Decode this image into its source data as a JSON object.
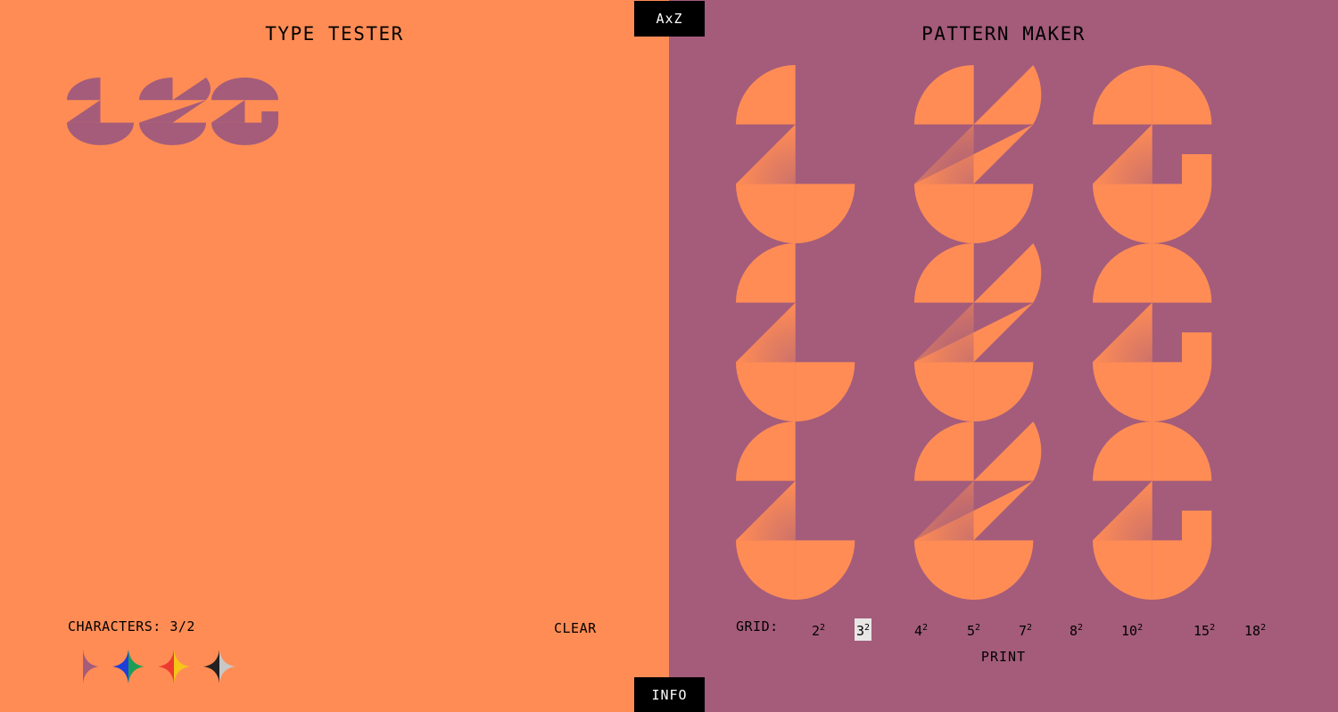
{
  "colors": {
    "orange": "#FF8C55",
    "mauve": "#A45C7A",
    "black": "#000000",
    "highlight": "#e9e6e6"
  },
  "top_tab": {
    "label": "AxZ"
  },
  "bottom_tab": {
    "label": "INFO"
  },
  "type_tester": {
    "title": "TYPE TESTER",
    "characters_label": "CHARACTERS: 3/2",
    "clear_label": "CLEAR",
    "typed_glyphs": [
      "L",
      "Z",
      "G"
    ],
    "color_swatches": [
      {
        "name": "orange-mauve",
        "colors": [
          "#A45C7A",
          "#FF8C55"
        ]
      },
      {
        "name": "green-blue",
        "colors": [
          "#1F9D57",
          "#1F3FDB"
        ]
      },
      {
        "name": "yellow-red",
        "colors": [
          "#F5C518",
          "#EE3B32"
        ]
      },
      {
        "name": "grey-black",
        "colors": [
          "#C8C8C8",
          "#222222"
        ]
      }
    ]
  },
  "pattern_maker": {
    "title": "PATTERN MAKER",
    "grid_label": "GRID:",
    "grid_options": [
      {
        "base": "2",
        "exp": "2"
      },
      {
        "base": "3",
        "exp": "2"
      },
      {
        "base": "4",
        "exp": "2"
      },
      {
        "base": "5",
        "exp": "2"
      },
      {
        "base": "7",
        "exp": "2"
      },
      {
        "base": "8",
        "exp": "2"
      },
      {
        "base": "10",
        "exp": "2"
      },
      {
        "base": "15",
        "exp": "2"
      },
      {
        "base": "18",
        "exp": "2"
      }
    ],
    "selected_grid": "3",
    "print_label": "PRINT",
    "pattern_rows": [
      "LZG",
      "LZG",
      "LZG"
    ]
  }
}
